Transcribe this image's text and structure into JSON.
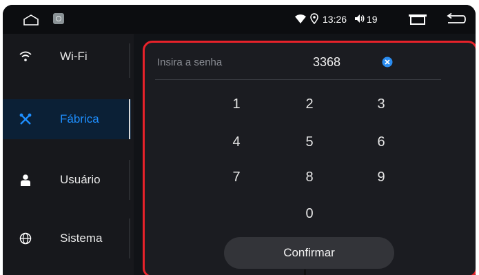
{
  "statusbar": {
    "time": "13:26",
    "volume": "19",
    "icons": [
      "home-icon",
      "app-icon",
      "wifi-icon",
      "location-pin-icon",
      "volume-icon",
      "recent-apps-icon",
      "back-icon"
    ]
  },
  "sidebar": {
    "items": [
      {
        "label": "Wi-Fi",
        "icon": "wifi-icon",
        "active": false
      },
      {
        "label": "Fábrica",
        "icon": "tools-icon",
        "active": true
      },
      {
        "label": "Usuário",
        "icon": "user-icon",
        "active": false
      },
      {
        "label": "Sistema",
        "icon": "globe-icon",
        "active": false
      }
    ]
  },
  "password": {
    "placeholder": "Insira a senha",
    "value": "3368"
  },
  "keypad": {
    "keys": [
      "1",
      "2",
      "3",
      "4",
      "5",
      "6",
      "7",
      "8",
      "9",
      "0"
    ]
  },
  "confirm_label": "Confirmar",
  "colors": {
    "accent": "#1e8fff",
    "highlight_border": "#e8222a",
    "background": "#111317"
  }
}
